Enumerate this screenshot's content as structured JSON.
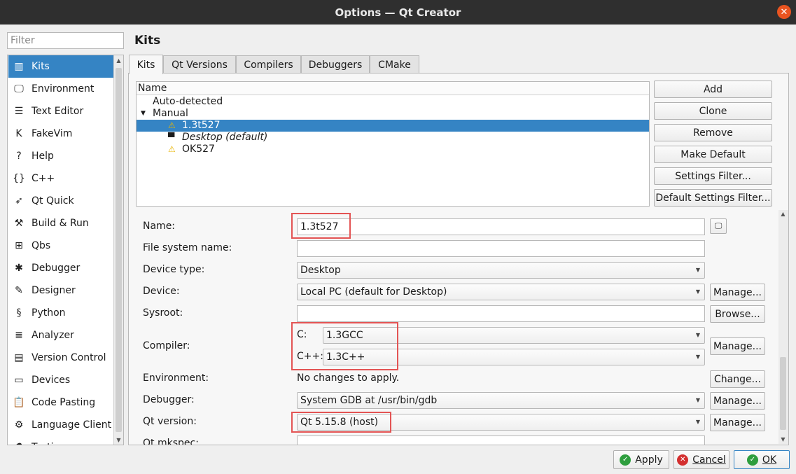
{
  "window": {
    "title": "Options — Qt Creator"
  },
  "filter": {
    "placeholder": "Filter"
  },
  "categories": [
    {
      "label": "Kits",
      "icon": "kits-icon",
      "glyph": "▥"
    },
    {
      "label": "Environment",
      "icon": "monitor-icon",
      "glyph": "🖵"
    },
    {
      "label": "Text Editor",
      "icon": "text-editor-icon",
      "glyph": "☰"
    },
    {
      "label": "FakeVim",
      "icon": "fakevim-icon",
      "glyph": "K"
    },
    {
      "label": "Help",
      "icon": "help-icon",
      "glyph": "?"
    },
    {
      "label": "C++",
      "icon": "cpp-braces-icon",
      "glyph": "{}"
    },
    {
      "label": "Qt Quick",
      "icon": "qt-quick-icon",
      "glyph": "➶"
    },
    {
      "label": "Build & Run",
      "icon": "hammer-icon",
      "glyph": "⚒"
    },
    {
      "label": "Qbs",
      "icon": "qbs-icon",
      "glyph": "⊞"
    },
    {
      "label": "Debugger",
      "icon": "bug-icon",
      "glyph": "✱"
    },
    {
      "label": "Designer",
      "icon": "pen-icon",
      "glyph": "✎"
    },
    {
      "label": "Python",
      "icon": "python-icon",
      "glyph": "§"
    },
    {
      "label": "Analyzer",
      "icon": "analyzer-icon",
      "glyph": "≣"
    },
    {
      "label": "Version Control",
      "icon": "version-control-icon",
      "glyph": "▤"
    },
    {
      "label": "Devices",
      "icon": "devices-icon",
      "glyph": "▭"
    },
    {
      "label": "Code Pasting",
      "icon": "clipboard-icon",
      "glyph": "📋"
    },
    {
      "label": "Language Client",
      "icon": "language-client-icon",
      "glyph": "⚙"
    },
    {
      "label": "Testing",
      "icon": "testing-icon",
      "glyph": "⚗"
    }
  ],
  "page": {
    "title": "Kits"
  },
  "tabs": [
    "Kits",
    "Qt Versions",
    "Compilers",
    "Debuggers",
    "CMake"
  ],
  "kit_tree": {
    "header": "Name",
    "rows": [
      {
        "label": "Auto-detected"
      },
      {
        "label": "Manual"
      },
      {
        "label": "1.3t527"
      },
      {
        "label": "Desktop (default)"
      },
      {
        "label": "OK527"
      }
    ]
  },
  "kit_buttons": [
    "Add",
    "Clone",
    "Remove",
    "Make Default",
    "Settings Filter...",
    "Default Settings Filter..."
  ],
  "form": {
    "name_label": "Name:",
    "name_value": "1.3t527",
    "fs_name_label": "File system name:",
    "fs_name_value": "",
    "device_type_label": "Device type:",
    "device_type_value": "Desktop",
    "device_label": "Device:",
    "device_value": "Local PC (default for Desktop)",
    "sysroot_label": "Sysroot:",
    "sysroot_value": "",
    "compiler_label": "Compiler:",
    "c_label": "C:",
    "c_value": "1.3GCC",
    "cpp_label": "C++:",
    "cpp_value": "1.3C++",
    "environment_label": "Environment:",
    "environment_value": "No changes to apply.",
    "debugger_label": "Debugger:",
    "debugger_value": "System GDB at /usr/bin/gdb",
    "qt_version_label": "Qt version:",
    "qt_version_value": "Qt 5.15.8 (host)",
    "qt_mkspec_label": "Qt mkspec:",
    "manage": "Manage...",
    "browse": "Browse...",
    "change": "Change..."
  },
  "footer": {
    "apply": "Apply",
    "cancel": "Cancel",
    "ok": "OK"
  },
  "colors": {
    "selection": "#3584c4",
    "highlight_box": "#e35454",
    "close": "#e95420"
  }
}
